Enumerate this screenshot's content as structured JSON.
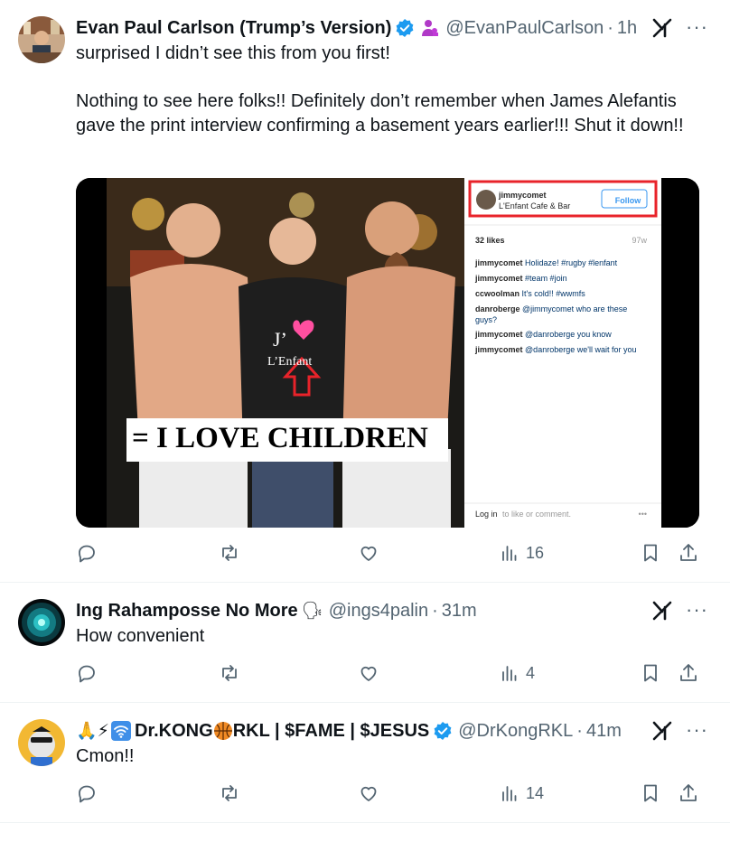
{
  "tweets": [
    {
      "display_name": "Evan Paul Carlson (Trump’s Version)",
      "handle": "@EvanPaulCarlson",
      "time": "1h",
      "text": [
        "surprised I didn’t see this from you first!",
        "Nothing to see here folks!! Definitely don’t remember when James Alefantis gave the print interview confirming a basement years earlier!!! Shut it down!!"
      ],
      "views": "16",
      "icons": [
        "verified-icon",
        "person-emoji-icon",
        "grok-icon",
        "more-icon"
      ]
    },
    {
      "display_name": "Ing Rahamposse No More",
      "emoji": "🗣",
      "handle": "@ings4palin",
      "time": "31m",
      "text": [
        "How convenient"
      ],
      "views": "4"
    },
    {
      "display_name_prefix": "🙏⚡",
      "display_name": "Dr.KONG",
      "display_name_suffix": "RKL | $FAME | $JESUS",
      "handle": "@DrKongRKL",
      "time": "41m",
      "text": [
        "Cmon!!"
      ],
      "views": "14"
    }
  ],
  "dot": "·",
  "more": "···",
  "media": {
    "instagram": {
      "username": "jimmycomet",
      "location": "L'Enfant Cafe & Bar",
      "follow": "Follow",
      "likes": "32 likes",
      "age": "97w",
      "comments": [
        {
          "user": "jimmycomet",
          "text": "Holidaze! #rugby #lenfant"
        },
        {
          "user": "jimmycomet",
          "text": "#team #join"
        },
        {
          "user": "ccwoolman",
          "text": "It's cold!! #wwmfs"
        },
        {
          "user": "danroberge",
          "text": "@jimmycomet who are these guys?"
        },
        {
          "user": "jimmycomet",
          "text": "@danroberge you know"
        },
        {
          "user": "jimmycomet",
          "text": "@danroberge we'll wait for you"
        }
      ],
      "login_prefix": "Log in",
      "login_suffix": "to like or comment.",
      "dots": "•••"
    },
    "caption": "= I LOVE CHILDREN",
    "shirt_text_1": "J’",
    "shirt_text_2": "L’Enfant"
  },
  "colors": {
    "accent": "#1d9bf0",
    "muted": "#536471",
    "text": "#0f1419",
    "red": "#e8232a"
  }
}
